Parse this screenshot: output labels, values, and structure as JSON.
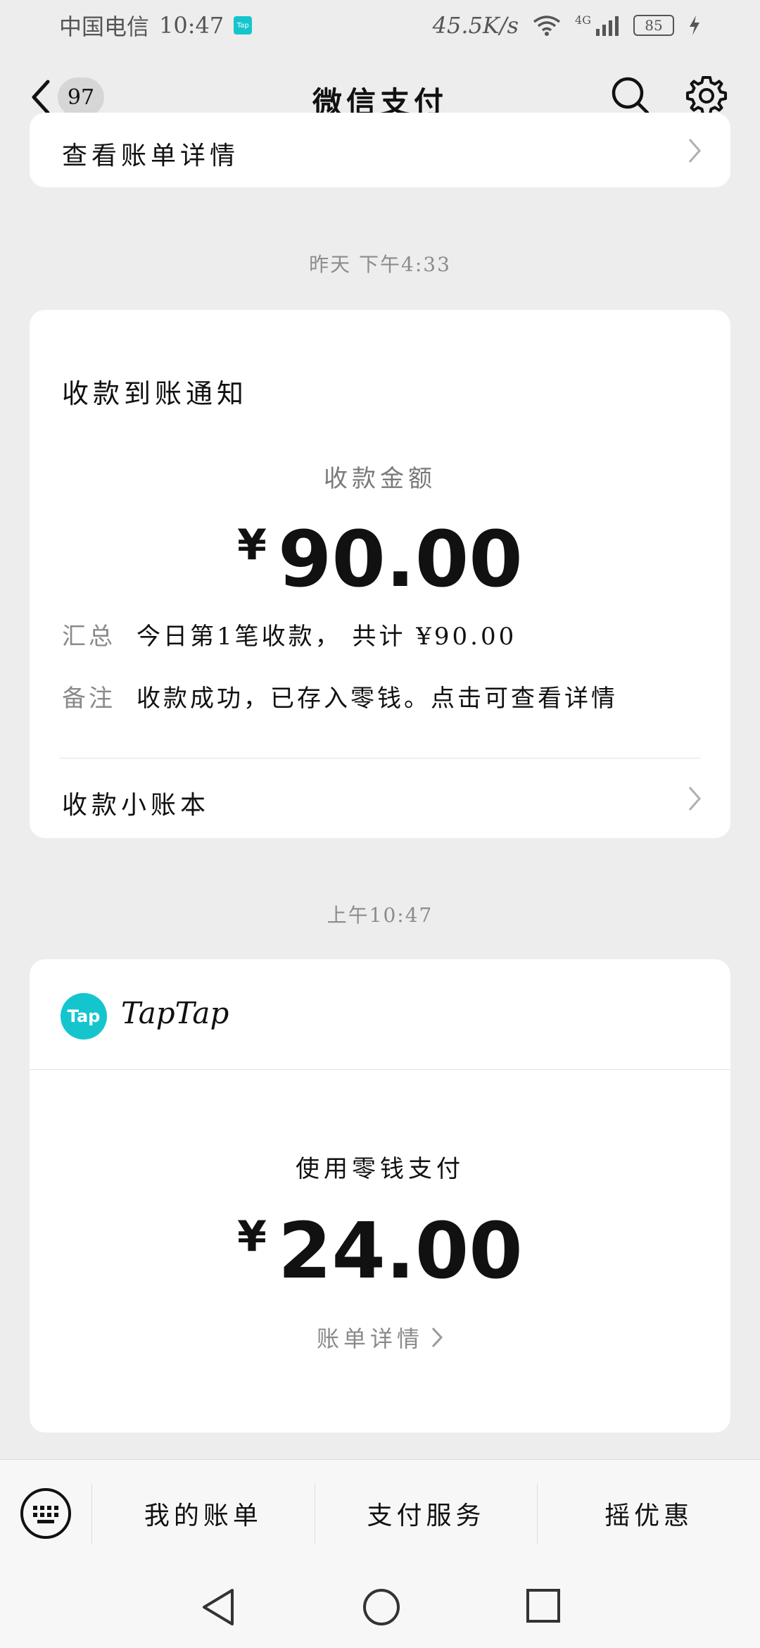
{
  "status_bar": {
    "carrier": "中国电信",
    "time": "10:47",
    "net_speed": "45.5K/s",
    "network": "4G",
    "battery": "85"
  },
  "nav": {
    "unread_count": "97",
    "title": "微信支付"
  },
  "top_card": {
    "label": "查看账单详情"
  },
  "msg1": {
    "timestamp": "昨天 下午4:33",
    "title": "收款到账通知",
    "amount_label": "收款金额",
    "currency": "¥",
    "amount": "90.00",
    "summary_key": "汇总",
    "summary_value": "今日第1笔收款， 共计 ¥90.00",
    "note_key": "备注",
    "note_value": "收款成功，已存入零钱。点击可查看详情",
    "ledger_label": "收款小账本"
  },
  "msg2": {
    "timestamp": "上午10:47",
    "merchant_logo_text": "Tap",
    "merchant_name": "TapTap",
    "pay_method": "使用零钱支付",
    "currency": "¥",
    "amount": "24.00",
    "bill_link": "账单详情"
  },
  "bottom_menu": {
    "items": [
      "我的账单",
      "支付服务",
      "摇优惠"
    ]
  },
  "colors": {
    "background": "#ededed",
    "card": "#ffffff",
    "tap_brand": "#15c5ce"
  }
}
